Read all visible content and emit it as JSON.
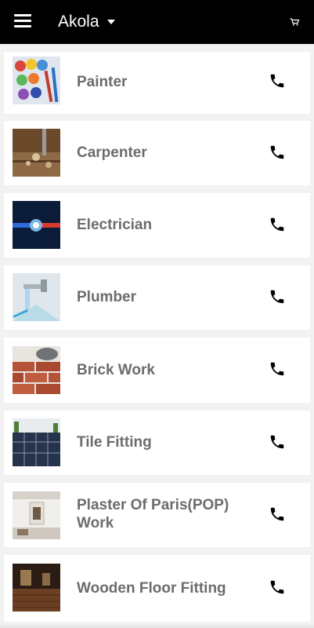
{
  "appbar": {
    "city": "Akola",
    "menu_icon": "hamburger-menu-icon",
    "dropdown_icon": "caret-down-icon",
    "cart_icon": "cart-icon"
  },
  "services": [
    {
      "label": "Painter",
      "thumb": "paint-cans-image"
    },
    {
      "label": "Carpenter",
      "thumb": "wood-drill-image"
    },
    {
      "label": "Electrician",
      "thumb": "electric-wire-image"
    },
    {
      "label": "Plumber",
      "thumb": "water-faucet-image"
    },
    {
      "label": "Brick Work",
      "thumb": "brick-wall-image"
    },
    {
      "label": "Tile Fitting",
      "thumb": "tiled-floor-image"
    },
    {
      "label": "Plaster Of Paris(POP) Work",
      "thumb": "pop-ceiling-image"
    },
    {
      "label": "Wooden Floor Fitting",
      "thumb": "wooden-floor-image"
    }
  ],
  "colors": {
    "appbar": "#000000",
    "background": "#f2f2f2",
    "card": "#ffffff",
    "title_text": "#6c6c6c"
  }
}
